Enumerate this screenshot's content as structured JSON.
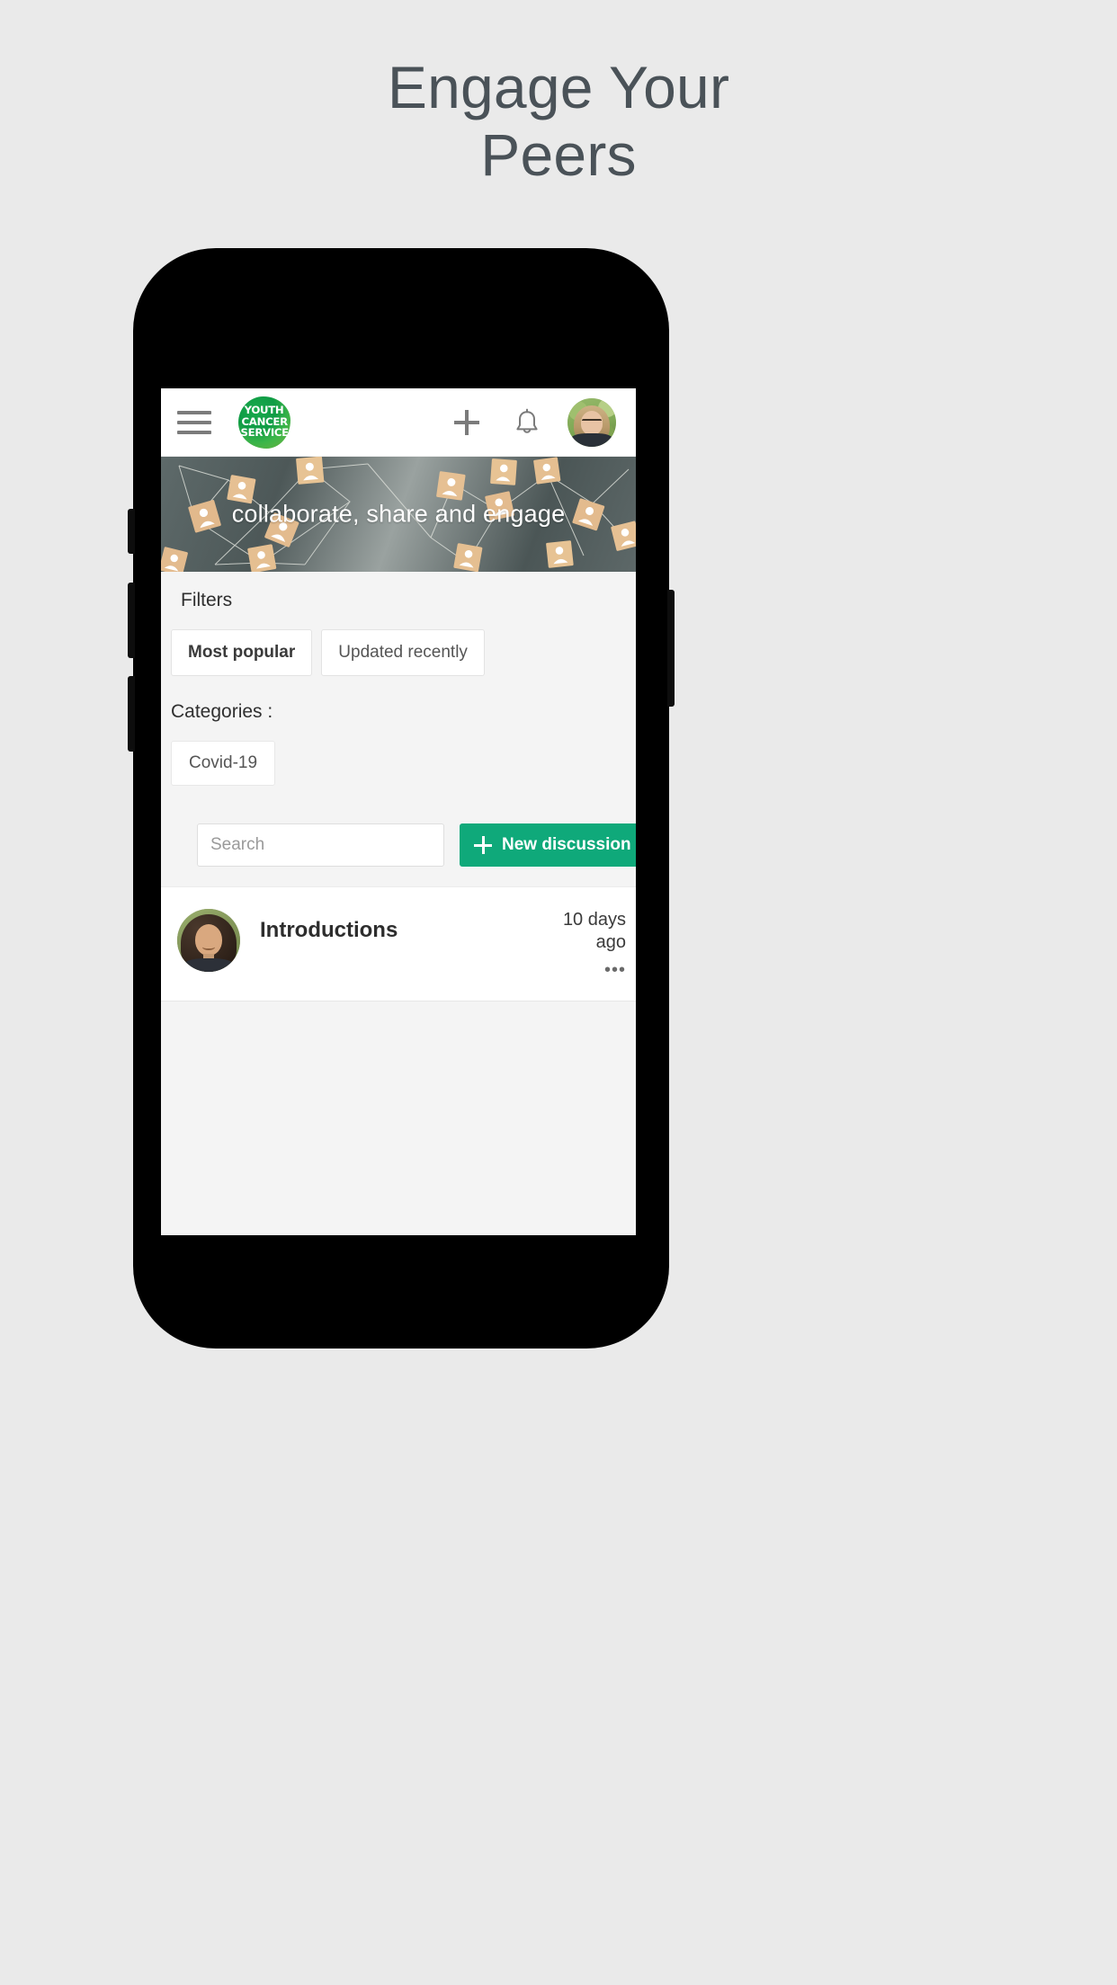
{
  "page": {
    "headline": "Engage Your\nPeers",
    "background_color": "#eaeaea",
    "headline_color": "#4a5258"
  },
  "appbar": {
    "menu_icon": "hamburger-icon",
    "logo_lines": [
      "YOUTH",
      "CANCER",
      "SERVICE"
    ],
    "logo_color": "#18a94c",
    "add_icon": "plus-icon",
    "notifications_icon": "bell-icon",
    "avatar": "user-avatar"
  },
  "hero": {
    "caption": "collaborate, share and engage",
    "image": "network-of-wooden-person-blocks"
  },
  "filters": {
    "title": "Filters",
    "options": [
      {
        "label": "Most popular",
        "active": true
      },
      {
        "label": "Updated recently",
        "active": false
      }
    ]
  },
  "categories": {
    "title": "Categories :",
    "items": [
      {
        "label": "Covid-19"
      }
    ]
  },
  "search": {
    "placeholder": "Search",
    "value": ""
  },
  "actions": {
    "new_discussion_label": "New discussion",
    "new_discussion_color": "#0fa97a",
    "new_discussion_icon": "plus-icon"
  },
  "discussions": [
    {
      "title": "Introductions",
      "time": "10 days ago",
      "more_icon": "•••",
      "avatar": "discussion-author-avatar"
    }
  ]
}
